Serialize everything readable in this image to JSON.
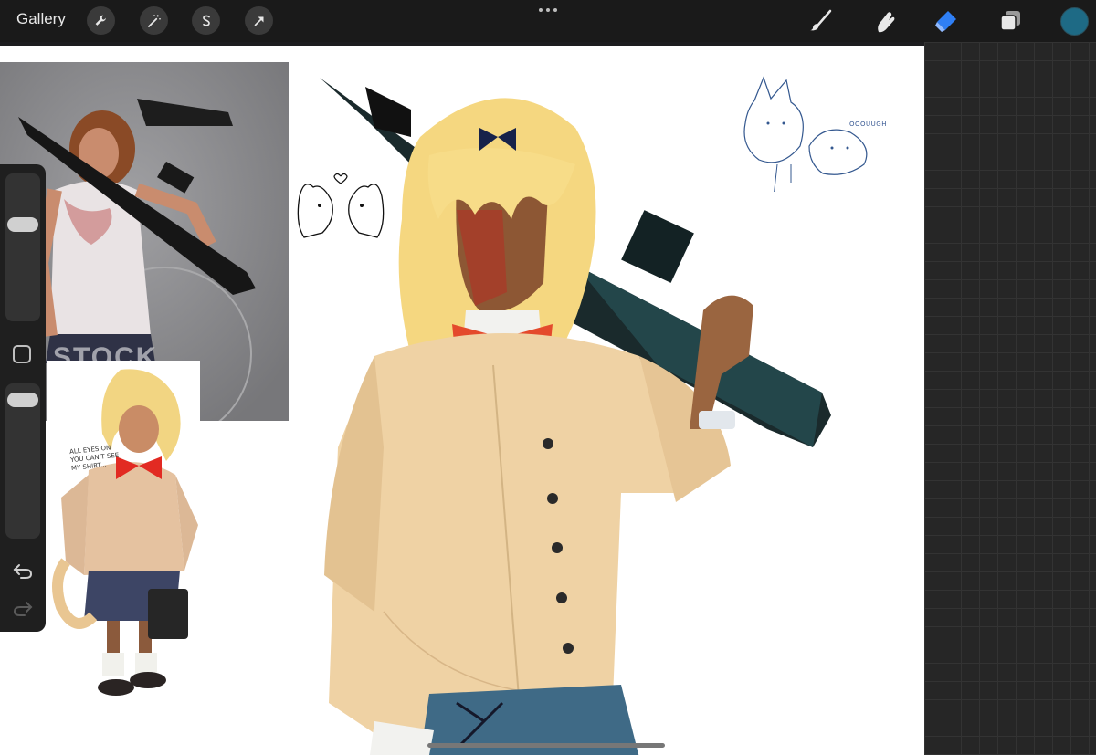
{
  "topbar": {
    "gallery_label": "Gallery",
    "left_tools": [
      "wrench-icon",
      "magic-wand-icon",
      "selection-icon",
      "transform-arrow-icon"
    ],
    "right_tools": [
      "brush-icon",
      "smudge-icon",
      "eraser-icon",
      "layers-icon"
    ],
    "active_tool": "eraser-icon",
    "current_color": "#1e6a85"
  },
  "canvas": {
    "ref_photo_watermark": "STOCK",
    "sketch_note": "ALL EYES ON YOU CAN'T SEE MY SHIRT...",
    "doodle_text": "OOOUUGH"
  },
  "colors": {
    "accent_blue": "#2f7ff5",
    "toolbar_bg": "#1a1a1a"
  }
}
